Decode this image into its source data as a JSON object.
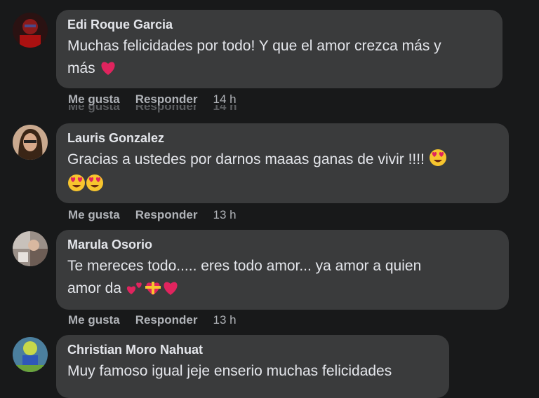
{
  "comments": [
    {
      "author": "Edi Roque Garcia",
      "text_line1": "Muchas felicidades por todo! Y que el amor crezca más y",
      "text_line2": "más",
      "like": "Me gusta",
      "reply": "Responder",
      "time": "14 h",
      "emojis": [
        "heart-emoji"
      ]
    },
    {
      "author": "Lauris Gonzalez",
      "text_line1": "Gracias a ustedes por darnos maaas ganas de vivir !!!!",
      "text_line2": "",
      "like": "Me gusta",
      "reply": "Responder",
      "time": "13 h",
      "emojis": [
        "heart-eyes-emoji",
        "heart-eyes-emoji",
        "heart-eyes-emoji"
      ]
    },
    {
      "author": "Marula Osorio",
      "text_line1": "Te mereces todo..... eres todo amor... ya amor a quien",
      "text_line2": "amor da",
      "like": "Me gusta",
      "reply": "Responder",
      "time": "13 h",
      "emojis": [
        "two-hearts-emoji",
        "heart-gift-emoji",
        "heart-emoji"
      ]
    },
    {
      "author": "Christian Moro Nahuat",
      "text_line1": "Muy famoso igual jeje enserio muchas felicidades",
      "text_line2": ""
    }
  ],
  "colors": {
    "background": "#18191a",
    "bubble": "#3a3b3c",
    "text": "#e4e6eb",
    "secondary": "#b0b3b8",
    "heart": "#e0245e",
    "emoji_face": "#f7c52e"
  }
}
